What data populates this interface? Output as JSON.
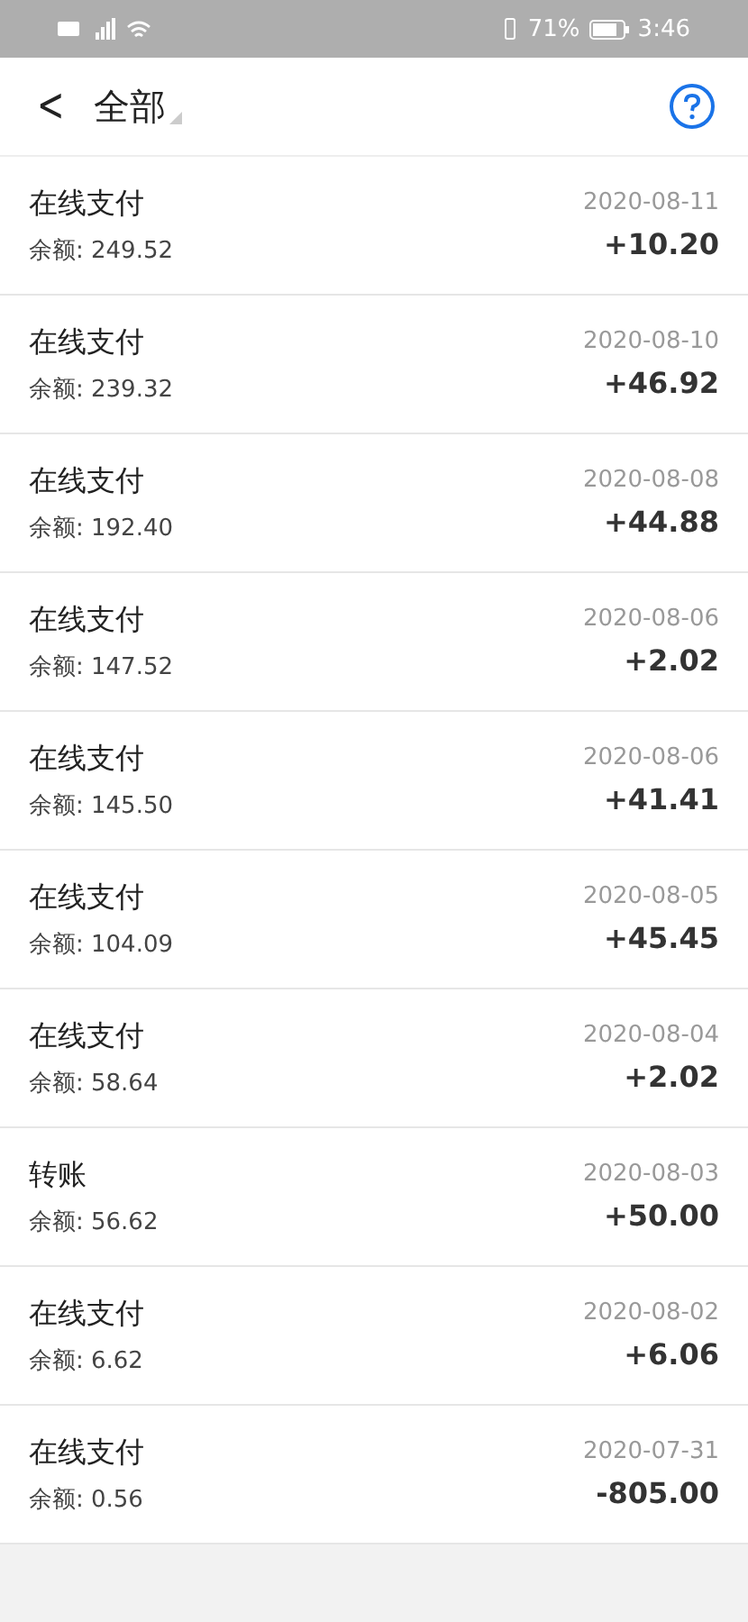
{
  "status_bar": {
    "battery_percent": "71%",
    "time": "3:46"
  },
  "header": {
    "back": "<",
    "title": "全部"
  },
  "transactions": [
    {
      "title": "在线支付",
      "balance": "余额: 249.52",
      "date": "2020-08-11",
      "amount": "+10.20"
    },
    {
      "title": "在线支付",
      "balance": "余额: 239.32",
      "date": "2020-08-10",
      "amount": "+46.92"
    },
    {
      "title": "在线支付",
      "balance": "余额: 192.40",
      "date": "2020-08-08",
      "amount": "+44.88"
    },
    {
      "title": "在线支付",
      "balance": "余额: 147.52",
      "date": "2020-08-06",
      "amount": "+2.02"
    },
    {
      "title": "在线支付",
      "balance": "余额: 145.50",
      "date": "2020-08-06",
      "amount": "+41.41"
    },
    {
      "title": "在线支付",
      "balance": "余额: 104.09",
      "date": "2020-08-05",
      "amount": "+45.45"
    },
    {
      "title": "在线支付",
      "balance": "余额: 58.64",
      "date": "2020-08-04",
      "amount": "+2.02"
    },
    {
      "title": "转账",
      "balance": "余额: 56.62",
      "date": "2020-08-03",
      "amount": "+50.00"
    },
    {
      "title": "在线支付",
      "balance": "余额: 6.62",
      "date": "2020-08-02",
      "amount": "+6.06"
    },
    {
      "title": "在线支付",
      "balance": "余额: 0.56",
      "date": "2020-07-31",
      "amount": "-805.00"
    }
  ]
}
